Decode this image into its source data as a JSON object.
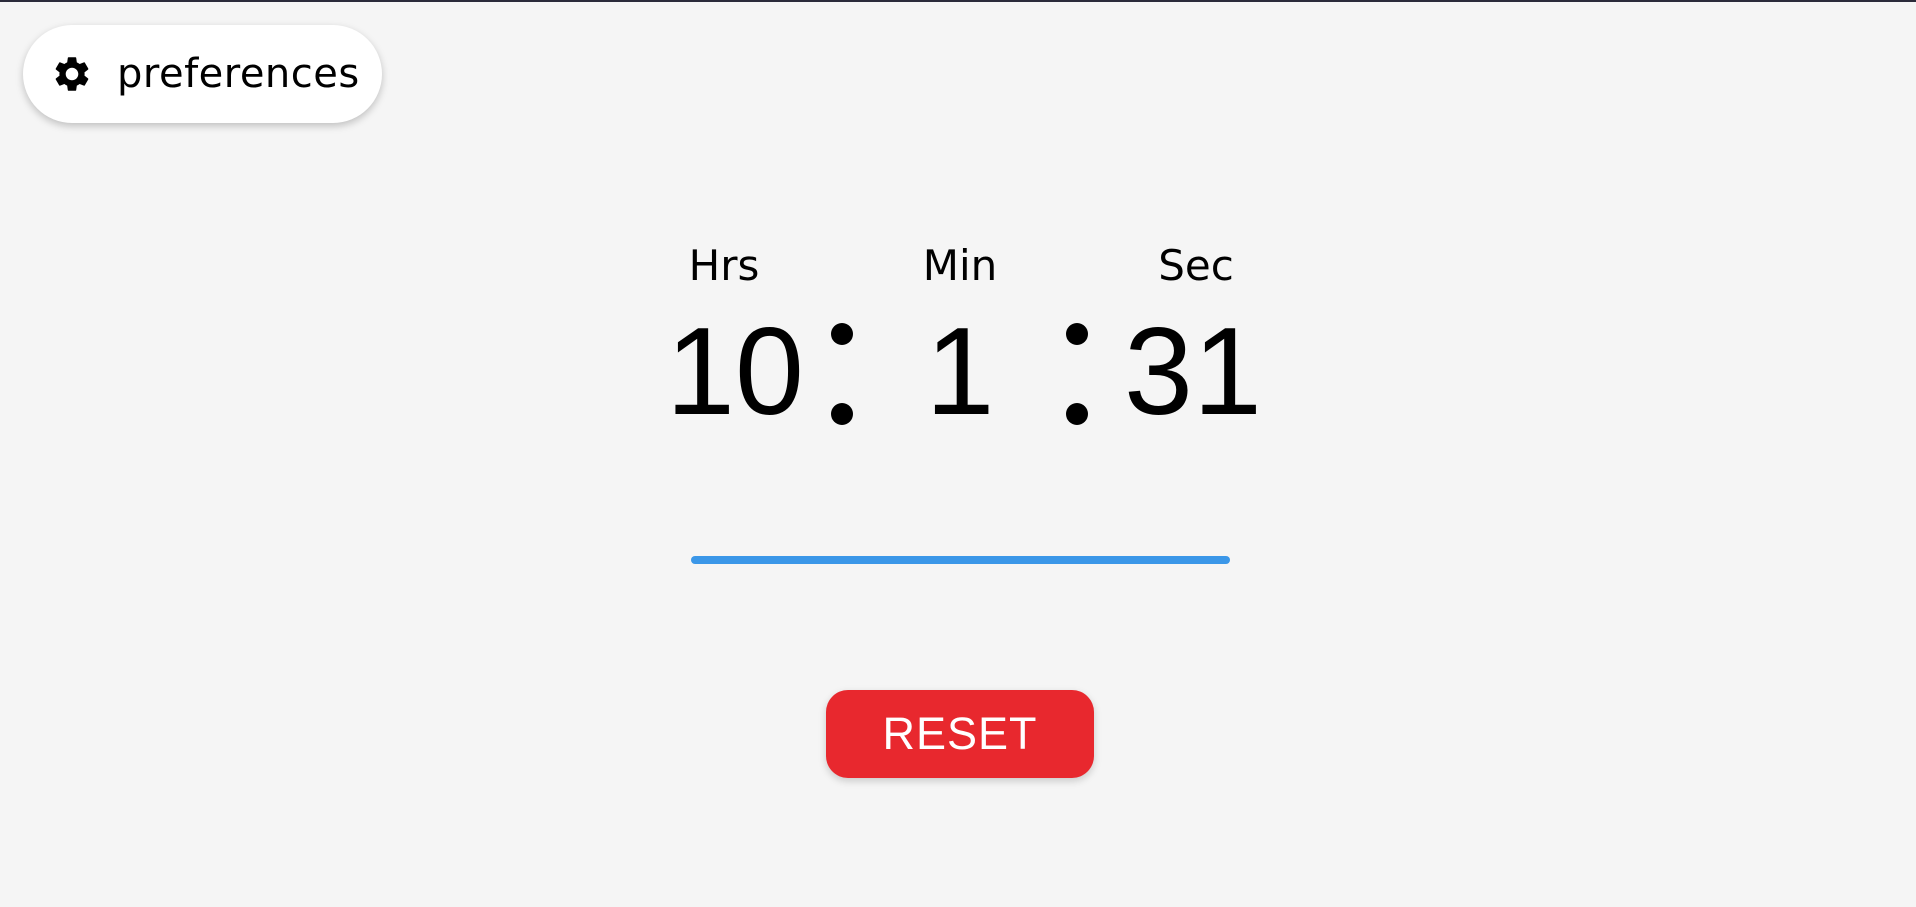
{
  "preferences": {
    "label": "preferences",
    "icon": "gear-icon"
  },
  "timer": {
    "units": {
      "hours": "Hrs",
      "minutes": "Min",
      "seconds": "Sec"
    },
    "values": {
      "hours": "10",
      "minutes": "1",
      "seconds": "31"
    },
    "separator": ":"
  },
  "progress": {
    "fraction": 1.0,
    "color": "#3b97e8"
  },
  "reset": {
    "label": "RESET",
    "color": "#e8282e"
  }
}
